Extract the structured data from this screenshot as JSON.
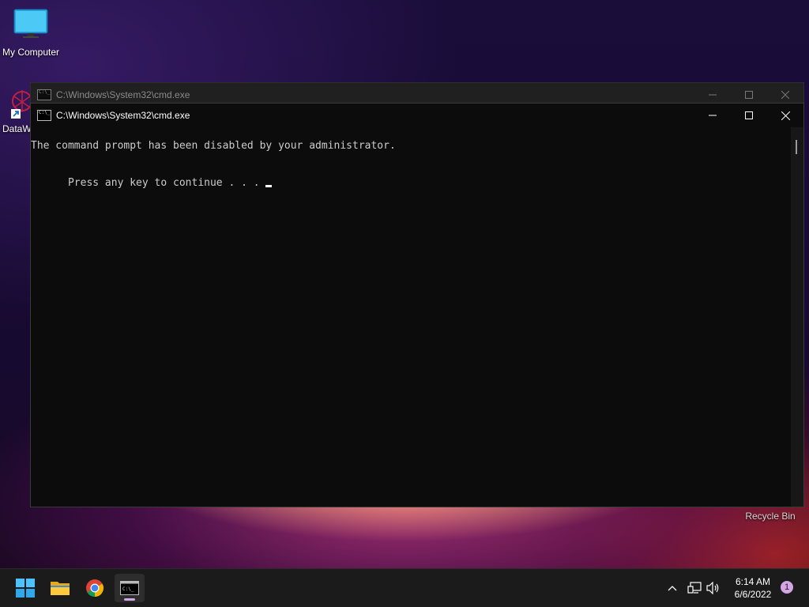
{
  "desktop": {
    "icons": [
      {
        "label": "My Computer"
      },
      {
        "label": "DataW"
      },
      {
        "label": "Recycle Bin"
      }
    ]
  },
  "windows": {
    "back": {
      "title": "C:\\Windows\\System32\\cmd.exe"
    },
    "front": {
      "title": "C:\\Windows\\System32\\cmd.exe",
      "lines": [
        "The command prompt has been disabled by your administrator.",
        "Press any key to continue . . . "
      ]
    }
  },
  "taskbar": {
    "apps": [
      {
        "name": "start",
        "icon": "windows-logo-icon"
      },
      {
        "name": "file-explorer",
        "icon": "folder-icon"
      },
      {
        "name": "chrome",
        "icon": "chrome-icon"
      },
      {
        "name": "cmd",
        "icon": "terminal-icon",
        "active": true
      }
    ],
    "clock": {
      "time": "6:14 AM",
      "date": "6/6/2022"
    },
    "notification_count": "1"
  },
  "colors": {
    "accent": "#4cc2ff",
    "terminal_bg": "#0c0c0c",
    "terminal_text": "#cccccc",
    "notification_badge": "#d5a6e6"
  }
}
